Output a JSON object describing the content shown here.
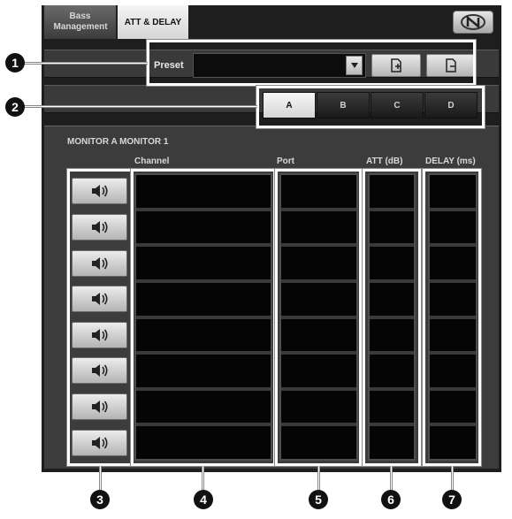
{
  "tabs": {
    "bass_management": "Bass Management",
    "att_delay": "ATT & DELAY"
  },
  "preset": {
    "label": "Preset",
    "value": "",
    "dropdown_icon": "triangle-down"
  },
  "monitor_buttons": [
    "A",
    "B",
    "C",
    "D"
  ],
  "monitor_selected": "A",
  "section": {
    "title": "MONITOR A  MONITOR 1"
  },
  "columns": {
    "channel": "Channel",
    "port": "Port",
    "att": "ATT (dB)",
    "delay": "DELAY (ms)"
  },
  "rows": 8,
  "callouts": [
    "1",
    "2",
    "3",
    "4",
    "5",
    "6",
    "7"
  ],
  "icons": {
    "speaker": "speaker-icon",
    "preset_load": "file-load-icon",
    "preset_save": "file-save-icon",
    "logo": "brand-logo-icon"
  },
  "colors": {
    "panel_bg": "#1e1e1e",
    "main_bg": "#3c3c3c",
    "cell_bg": "#050505",
    "active_tab": "#e0e0e0",
    "callout": "#ffffff"
  }
}
